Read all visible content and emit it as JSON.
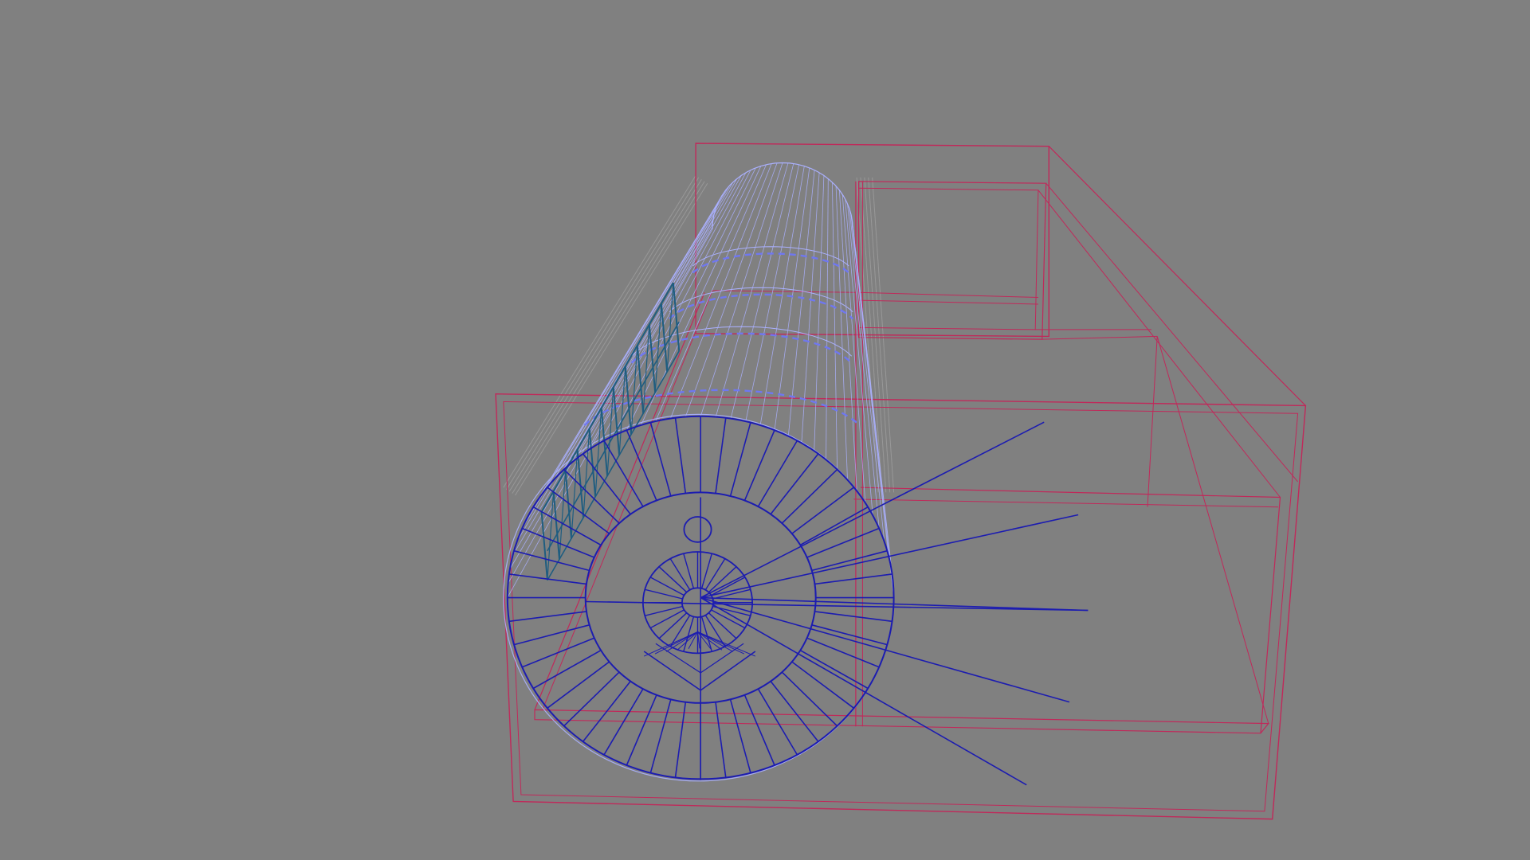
{
  "viewport": {
    "background": "#808080",
    "render_mode": "wireframe"
  },
  "colors": {
    "frame_wire": "#c0295a",
    "drum_wire": "#aab0ff",
    "drum_ring_wire": "#6f77f0",
    "rail_wire": "#1f5d80",
    "stair_wire": "#1c1cb0",
    "ghost_wire": "#9a9a9a"
  },
  "objects": [
    {
      "name": "room-frame",
      "type": "box-wireframe"
    },
    {
      "name": "tunnel-drum",
      "type": "cylinder-wireframe",
      "segments": 40
    },
    {
      "name": "handrail",
      "type": "posts-wireframe",
      "posts": 12
    },
    {
      "name": "spiral-staircase",
      "type": "radial-wireframe",
      "treads": 48
    },
    {
      "name": "core-fan",
      "type": "radial-wireframe",
      "blades": 24
    },
    {
      "name": "ghost-pipes",
      "type": "cylinder-wireframe",
      "count": 2
    }
  ]
}
